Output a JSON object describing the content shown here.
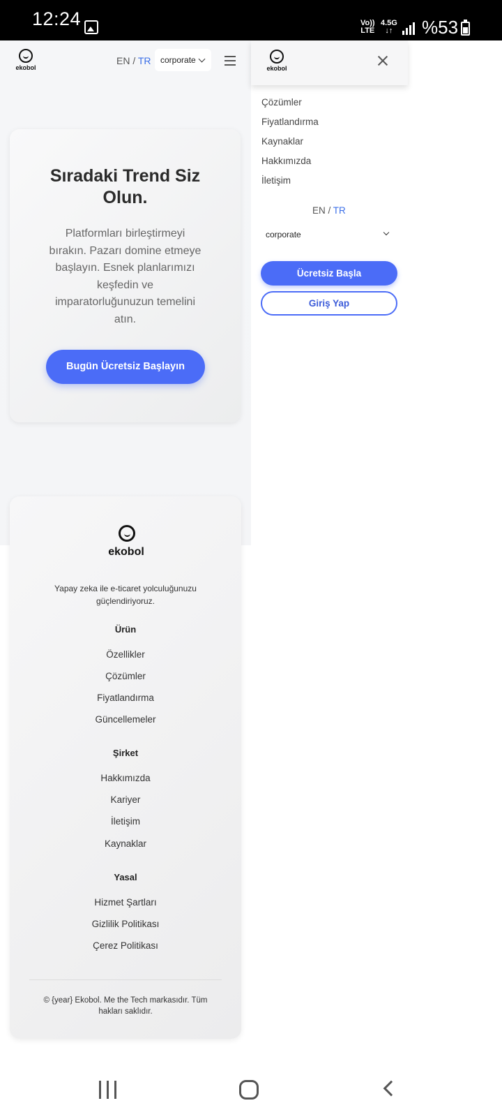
{
  "status_bar": {
    "time": "12:24",
    "network_volte": "Vo))",
    "network_lte": "LTE",
    "network_gen": "4.5G",
    "network_arrows": "↓↑",
    "battery": "%53",
    "battery_level_percent": 53
  },
  "header": {
    "logo_text": "ekobol",
    "lang_en": "EN",
    "lang_sep": " / ",
    "lang_tr": "TR",
    "theme_value": "corporate"
  },
  "hero": {
    "title": "Sıradaki Trend Siz Olun.",
    "description": "Platformları birleştirmeyi bırakın. Pazarı domine etmeye başlayın. Esnek planlarımızı keşfedin ve imparatorluğunuzun temelini atın.",
    "cta_label": "Bugün Ücretsiz Başlayın"
  },
  "footer": {
    "logo_text": "ekobol",
    "tagline": "Yapay zeka ile e-ticaret yolculuğunuzu güçlendiriyoruz.",
    "sections": [
      {
        "title": "Ürün",
        "links": [
          "Özellikler",
          "Çözümler",
          "Fiyatlandırma",
          "Güncellemeler"
        ]
      },
      {
        "title": "Şirket",
        "links": [
          "Hakkımızda",
          "Kariyer",
          "İletişim",
          "Kaynaklar"
        ]
      },
      {
        "title": "Yasal",
        "links": [
          "Hizmet Şartları",
          "Gizlilik Politikası",
          "Çerez Politikası"
        ]
      }
    ],
    "copyright": "© {year} Ekobol. Me the Tech markasıdır. Tüm hakları saklıdır."
  },
  "drawer": {
    "logo_text": "ekobol",
    "nav_items": [
      "Çözümler",
      "Fiyatlandırma",
      "Kaynaklar",
      "Hakkımızda",
      "İletişim"
    ],
    "lang_en": "EN",
    "lang_sep": " / ",
    "lang_tr": "TR",
    "theme_value": "corporate",
    "primary_button": "Ücretsiz Başla",
    "secondary_button": "Giriş Yap"
  },
  "colors": {
    "accent": "#4b6cf7",
    "link_active": "#3b6fe8",
    "status_bar_bg": "#000000"
  },
  "icons": [
    "image-icon",
    "signal-icon",
    "battery-icon",
    "menu-icon",
    "close-icon",
    "chevron-down-icon",
    "recent-apps-icon",
    "home-icon",
    "back-icon"
  ]
}
